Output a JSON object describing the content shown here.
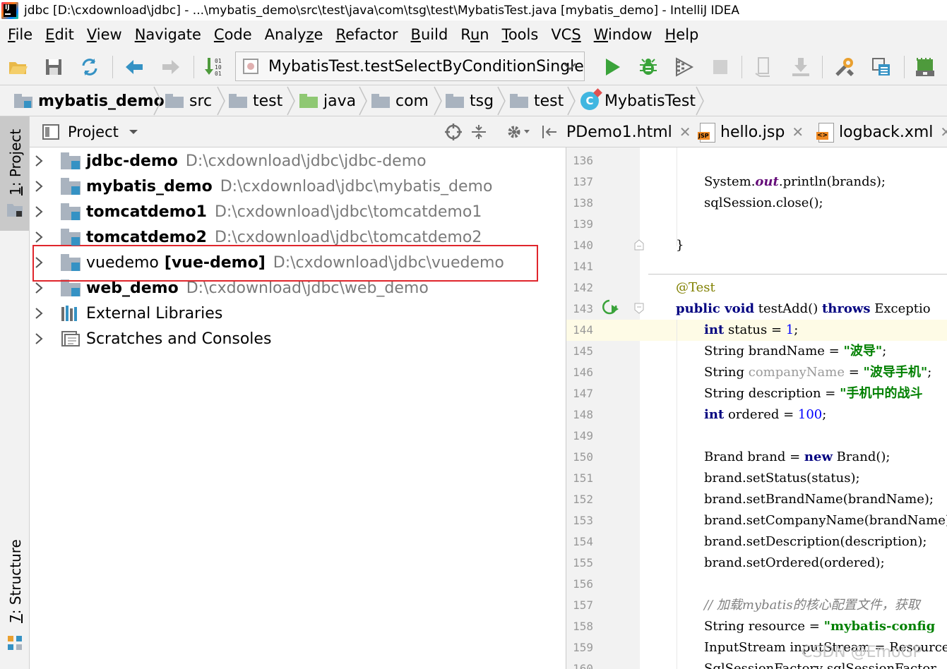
{
  "window": {
    "title": "jdbc [D:\\cxdownload\\jdbc] - ...\\mybatis_demo\\src\\test\\java\\com\\tsg\\test\\MybatisTest.java [mybatis_demo] - IntelliJ IDEA",
    "app_icon_letters": "IJ"
  },
  "menu": [
    {
      "mnemonic": "F",
      "rest": "ile"
    },
    {
      "mnemonic": "E",
      "rest": "dit"
    },
    {
      "mnemonic": "V",
      "rest": "iew"
    },
    {
      "mnemonic": "N",
      "rest": "avigate"
    },
    {
      "mnemonic": "C",
      "rest": "ode"
    },
    {
      "pre": "Analy",
      "mnemonic": "z",
      "rest": "e"
    },
    {
      "mnemonic": "R",
      "rest": "efactor"
    },
    {
      "mnemonic": "B",
      "rest": "uild"
    },
    {
      "pre": "R",
      "mnemonic": "u",
      "rest": "n"
    },
    {
      "mnemonic": "T",
      "rest": "ools"
    },
    {
      "pre": "VC",
      "mnemonic": "S",
      "rest": ""
    },
    {
      "mnemonic": "W",
      "rest": "indow"
    },
    {
      "mnemonic": "H",
      "rest": "elp"
    }
  ],
  "toolbar": {
    "run_config": "MybatisTest.testSelectByConditionSingle"
  },
  "breadcrumbs": [
    "mybatis_demo",
    "src",
    "test",
    "java",
    "com",
    "tsg",
    "test",
    "MybatisTest"
  ],
  "left_strip": {
    "project_tab": {
      "mnemonic": "1",
      "label": ": Project"
    },
    "structure_tab": {
      "mnemonic": "7",
      "label": ": Structure"
    }
  },
  "project_panel": {
    "title": "Project",
    "rows": [
      {
        "name": "jdbc-demo",
        "path": "D:\\cxdownload\\jdbc\\jdbc-demo",
        "bold": true
      },
      {
        "name": "mybatis_demo",
        "path": "D:\\cxdownload\\jdbc\\mybatis_demo",
        "bold": true
      },
      {
        "name": "tomcatdemo1",
        "path": "D:\\cxdownload\\jdbc\\tomcatdemo1",
        "bold": true
      },
      {
        "name": "tomcatdemo2",
        "path": "D:\\cxdownload\\jdbc\\tomcatdemo2",
        "bold": true
      },
      {
        "name": "vuedemo",
        "alias": "[vue-demo]",
        "path": "D:\\cxdownload\\jdbc\\vuedemo",
        "bold": false
      },
      {
        "name": "web_demo",
        "path": "D:\\cxdownload\\jdbc\\web_demo",
        "bold": true
      },
      {
        "name": "External Libraries",
        "path": "",
        "bold": false
      },
      {
        "name": "Scratches and Consoles",
        "path": "",
        "bold": false
      }
    ]
  },
  "editor_tabs": [
    {
      "label": "PDemo1.html",
      "close": "✕"
    },
    {
      "label": "hello.jsp",
      "icon_text": "JSP",
      "close": "✕"
    },
    {
      "label": "logback.xml",
      "icon_text": "<>",
      "close": "✕"
    }
  ],
  "editor": {
    "line_numbers": [
      "136",
      "137",
      "138",
      "139",
      "140",
      "141",
      "142",
      "143",
      "144",
      "145",
      "146",
      "147",
      "148",
      "149",
      "150",
      "151",
      "152",
      "153",
      "154",
      "155",
      "156",
      "157",
      "158",
      "159",
      "160"
    ],
    "lines": {
      "l137a": "System.",
      "l137b": "out",
      "l137c": ".println(brands);",
      "l138": "sqlSession.close();",
      "l140": "}",
      "l142": "@Test",
      "l143a": "public void",
      "l143b": " testAdd() ",
      "l143c": "throws",
      "l143d": " Exceptio",
      "l144a": "int",
      "l144b": " status = ",
      "l144c": "1",
      "l144d": ";",
      "l145a": "String brandName = ",
      "l145b": "\"波导\"",
      "l145c": ";",
      "l146a": "String ",
      "l146b": "companyName",
      "l146c": " = ",
      "l146d": "\"波导手机\"",
      "l146e": ";",
      "l147a": "String description = ",
      "l147b": "\"手机中的战斗",
      "l148a": "int",
      "l148b": " ordered = ",
      "l148c": "100",
      "l148d": ";",
      "l150a": "Brand brand = ",
      "l150b": "new",
      "l150c": " Brand();",
      "l151": "brand.setStatus(status);",
      "l152": "brand.setBrandName(brandName);",
      "l153": "brand.setCompanyName(brandName);",
      "l154": "brand.setDescription(description);",
      "l155": "brand.setOrdered(ordered);",
      "l157": "// 加载mybatis的核心配置文件，获取",
      "l158a": "String resource = ",
      "l158b": "\"mybatis-config",
      "l159": "InputStream inputStream = Resources",
      "l160": "SqlSessionFactory sqlSessionFactor"
    }
  },
  "watermark": "CSDN @EmoGP"
}
